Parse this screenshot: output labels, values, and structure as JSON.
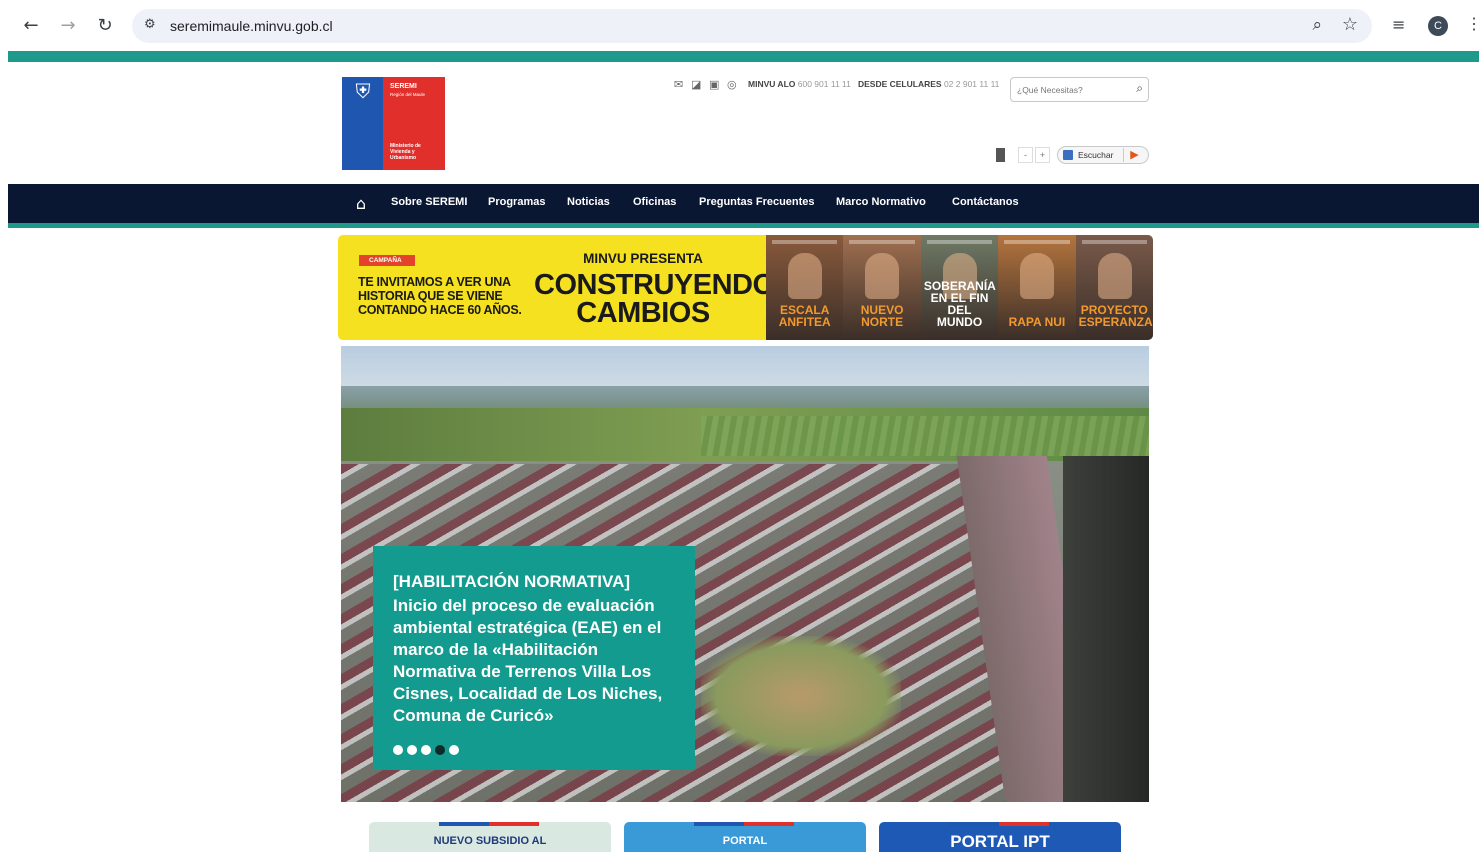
{
  "browser": {
    "url": "seremimaule.minvu.gob.cl",
    "profile_initial": "C"
  },
  "header": {
    "logo": {
      "line1": "SEREMI",
      "line2": "Región del Maule",
      "line3": "Ministerio de Vivienda y Urbanismo"
    },
    "phone": {
      "alo_label": "MINVU ALO",
      "alo_number": "600 901 11 11",
      "cell_label": "DESDE CELULARES",
      "cell_number": "02 2 901 11 11"
    },
    "search_placeholder": "¿Qué Necesitas?",
    "font_minus": "-",
    "font_plus": "+",
    "listen_label": "Escuchar"
  },
  "nav": {
    "items": [
      "Sobre SEREMI",
      "Programas",
      "Noticias",
      "Oficinas",
      "Preguntas Frecuentes",
      "Marco Normativo",
      "Contáctanos"
    ]
  },
  "campaign": {
    "badge": "CAMPAÑA",
    "invite": "TE INVITAMOS A VER UNA HISTORIA QUE SE VIENE CONTANDO HACE 60 AÑOS.",
    "pre_title": "MINVU PRESENTA",
    "title_line1": "CONSTRUYENDO",
    "title_line2": "CAMBIOS",
    "panels": [
      {
        "title": "ESCALA ANFITEA",
        "color": "#8a5a3c"
      },
      {
        "title": "NUEVO NORTE",
        "color": "#a07050"
      },
      {
        "title": "SOBERANÍA EN EL FIN DEL MUNDO",
        "color": "#6f7a66"
      },
      {
        "title": "RAPA NUI",
        "color": "#b5753e"
      },
      {
        "title": "PROYECTO ESPERANZA",
        "color": "#7a5a4a"
      }
    ]
  },
  "hero": {
    "tag": "[HABILITACIÓN NORMATIVA]",
    "body": "Inicio del proceso de evaluación ambiental estratégica (EAE) en el marco de la «Habilitación Normativa de Terrenos Villa Los Cisnes, Localidad de Los Niches, Comuna de Curicó»",
    "dot_count": 5,
    "active_dot": 3
  },
  "bottom_cards": [
    {
      "label": "NUEVO SUBSIDIO AL",
      "bg": "#d9e8e0",
      "fg": "#1e3a7a"
    },
    {
      "label": "PORTAL",
      "bg": "#3a9ad8",
      "fg": "#ffffff"
    },
    {
      "label": "PORTAL IPT",
      "bg": "#1e5ab5",
      "fg": "#ffffff"
    }
  ]
}
